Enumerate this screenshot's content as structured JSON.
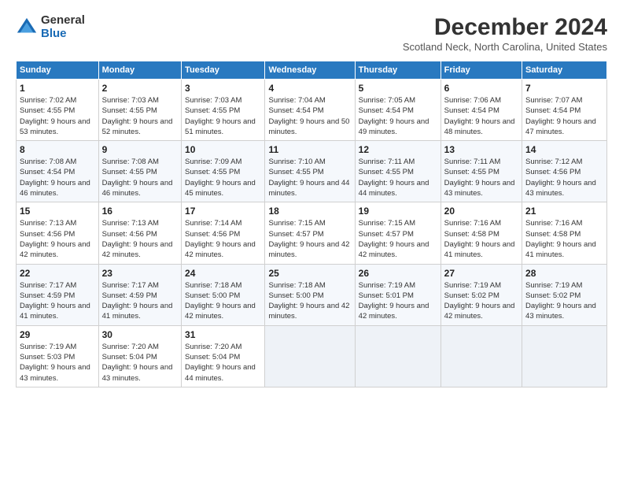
{
  "logo": {
    "general": "General",
    "blue": "Blue"
  },
  "title": "December 2024",
  "subtitle": "Scotland Neck, North Carolina, United States",
  "headers": [
    "Sunday",
    "Monday",
    "Tuesday",
    "Wednesday",
    "Thursday",
    "Friday",
    "Saturday"
  ],
  "weeks": [
    [
      {
        "day": "1",
        "sunrise": "7:02 AM",
        "sunset": "4:55 PM",
        "daylight": "9 hours and 53 minutes."
      },
      {
        "day": "2",
        "sunrise": "7:03 AM",
        "sunset": "4:55 PM",
        "daylight": "9 hours and 52 minutes."
      },
      {
        "day": "3",
        "sunrise": "7:03 AM",
        "sunset": "4:55 PM",
        "daylight": "9 hours and 51 minutes."
      },
      {
        "day": "4",
        "sunrise": "7:04 AM",
        "sunset": "4:54 PM",
        "daylight": "9 hours and 50 minutes."
      },
      {
        "day": "5",
        "sunrise": "7:05 AM",
        "sunset": "4:54 PM",
        "daylight": "9 hours and 49 minutes."
      },
      {
        "day": "6",
        "sunrise": "7:06 AM",
        "sunset": "4:54 PM",
        "daylight": "9 hours and 48 minutes."
      },
      {
        "day": "7",
        "sunrise": "7:07 AM",
        "sunset": "4:54 PM",
        "daylight": "9 hours and 47 minutes."
      }
    ],
    [
      {
        "day": "8",
        "sunrise": "7:08 AM",
        "sunset": "4:54 PM",
        "daylight": "9 hours and 46 minutes."
      },
      {
        "day": "9",
        "sunrise": "7:08 AM",
        "sunset": "4:55 PM",
        "daylight": "9 hours and 46 minutes."
      },
      {
        "day": "10",
        "sunrise": "7:09 AM",
        "sunset": "4:55 PM",
        "daylight": "9 hours and 45 minutes."
      },
      {
        "day": "11",
        "sunrise": "7:10 AM",
        "sunset": "4:55 PM",
        "daylight": "9 hours and 44 minutes."
      },
      {
        "day": "12",
        "sunrise": "7:11 AM",
        "sunset": "4:55 PM",
        "daylight": "9 hours and 44 minutes."
      },
      {
        "day": "13",
        "sunrise": "7:11 AM",
        "sunset": "4:55 PM",
        "daylight": "9 hours and 43 minutes."
      },
      {
        "day": "14",
        "sunrise": "7:12 AM",
        "sunset": "4:56 PM",
        "daylight": "9 hours and 43 minutes."
      }
    ],
    [
      {
        "day": "15",
        "sunrise": "7:13 AM",
        "sunset": "4:56 PM",
        "daylight": "9 hours and 42 minutes."
      },
      {
        "day": "16",
        "sunrise": "7:13 AM",
        "sunset": "4:56 PM",
        "daylight": "9 hours and 42 minutes."
      },
      {
        "day": "17",
        "sunrise": "7:14 AM",
        "sunset": "4:56 PM",
        "daylight": "9 hours and 42 minutes."
      },
      {
        "day": "18",
        "sunrise": "7:15 AM",
        "sunset": "4:57 PM",
        "daylight": "9 hours and 42 minutes."
      },
      {
        "day": "19",
        "sunrise": "7:15 AM",
        "sunset": "4:57 PM",
        "daylight": "9 hours and 42 minutes."
      },
      {
        "day": "20",
        "sunrise": "7:16 AM",
        "sunset": "4:58 PM",
        "daylight": "9 hours and 41 minutes."
      },
      {
        "day": "21",
        "sunrise": "7:16 AM",
        "sunset": "4:58 PM",
        "daylight": "9 hours and 41 minutes."
      }
    ],
    [
      {
        "day": "22",
        "sunrise": "7:17 AM",
        "sunset": "4:59 PM",
        "daylight": "9 hours and 41 minutes."
      },
      {
        "day": "23",
        "sunrise": "7:17 AM",
        "sunset": "4:59 PM",
        "daylight": "9 hours and 41 minutes."
      },
      {
        "day": "24",
        "sunrise": "7:18 AM",
        "sunset": "5:00 PM",
        "daylight": "9 hours and 42 minutes."
      },
      {
        "day": "25",
        "sunrise": "7:18 AM",
        "sunset": "5:00 PM",
        "daylight": "9 hours and 42 minutes."
      },
      {
        "day": "26",
        "sunrise": "7:19 AM",
        "sunset": "5:01 PM",
        "daylight": "9 hours and 42 minutes."
      },
      {
        "day": "27",
        "sunrise": "7:19 AM",
        "sunset": "5:02 PM",
        "daylight": "9 hours and 42 minutes."
      },
      {
        "day": "28",
        "sunrise": "7:19 AM",
        "sunset": "5:02 PM",
        "daylight": "9 hours and 43 minutes."
      }
    ],
    [
      {
        "day": "29",
        "sunrise": "7:19 AM",
        "sunset": "5:03 PM",
        "daylight": "9 hours and 43 minutes."
      },
      {
        "day": "30",
        "sunrise": "7:20 AM",
        "sunset": "5:04 PM",
        "daylight": "9 hours and 43 minutes."
      },
      {
        "day": "31",
        "sunrise": "7:20 AM",
        "sunset": "5:04 PM",
        "daylight": "9 hours and 44 minutes."
      },
      null,
      null,
      null,
      null
    ]
  ],
  "labels": {
    "sunrise": "Sunrise:",
    "sunset": "Sunset:",
    "daylight": "Daylight:"
  }
}
